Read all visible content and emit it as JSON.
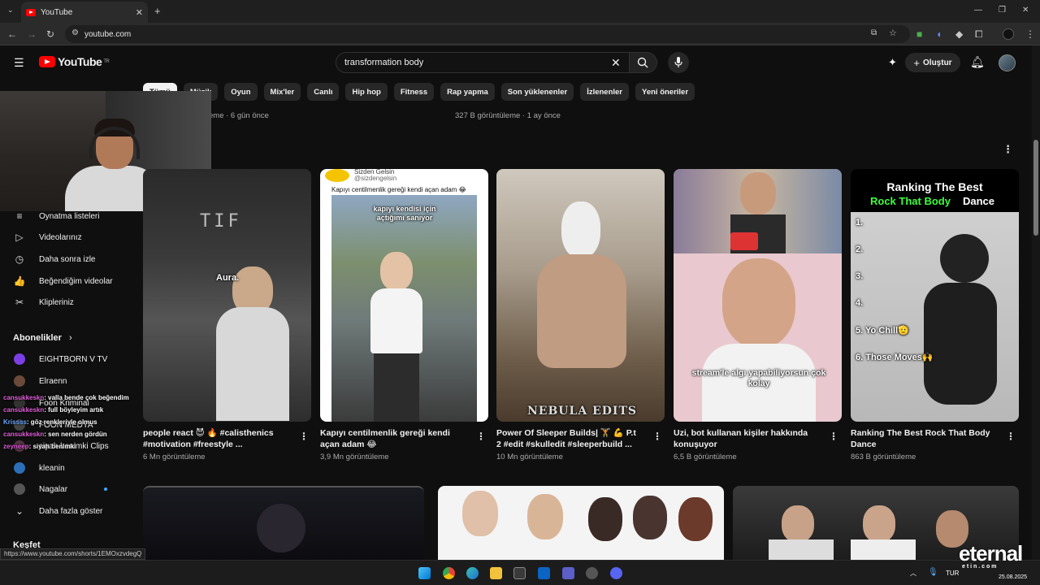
{
  "browser": {
    "tab_title": "YouTube",
    "tab_close": "✕",
    "new_tab": "+",
    "url": "youtube.com",
    "window_controls": [
      "—",
      "❐",
      "✕"
    ]
  },
  "header": {
    "logo_text": "YouTube",
    "logo_region": "TR",
    "search_value": "transformation body",
    "create_label": "Oluştur"
  },
  "chips": [
    "Tümü",
    "Müzik",
    "Oyun",
    "Mix'ler",
    "Canlı",
    "Hip hop",
    "Fitness",
    "Rap yapma",
    "Son yüklenenler",
    "İzlenenler",
    "Yeni öneriler"
  ],
  "above_meta": [
    {
      "text": "eme · 6 gün önce"
    },
    {
      "text": "327 B görüntüleme · 1 ay önce"
    }
  ],
  "sidebar": {
    "you_items": [
      {
        "label": "Oynatma listeleri",
        "icon": "playlist-icon",
        "glyph": "≡"
      },
      {
        "label": "Videolarınız",
        "icon": "video-icon",
        "glyph": "▷"
      },
      {
        "label": "Daha sonra izle",
        "icon": "clock-icon",
        "glyph": "◷"
      },
      {
        "label": "Beğendiğim videolar",
        "icon": "thumbs-up-icon",
        "glyph": "👍"
      },
      {
        "label": "Klipleriniz",
        "icon": "scissors-icon",
        "glyph": "✂"
      }
    ],
    "subscriptions_title": "Abonelikler",
    "subscriptions": [
      {
        "label": "EIGHTBORN V TV",
        "color": "#7b3fe4",
        "dot": false
      },
      {
        "label": "Elraenn",
        "color": "#6b4a3a",
        "dot": false
      },
      {
        "label": "Foon Kriminal",
        "color": "#333333",
        "dot": false
      },
      {
        "label": "FOON MEDYA",
        "color": "#444444",
        "dot": false
      },
      {
        "label": "siyah benimki Clips",
        "color": "#553344",
        "dot": false
      },
      {
        "label": "kleanin",
        "color": "#2a6fb8",
        "dot": false
      },
      {
        "label": "Nagalar",
        "color": "#555555",
        "dot": true
      }
    ],
    "show_more": "Daha fazla göster",
    "explore_title": "Keşfet"
  },
  "shorts": [
    {
      "title": "people react 😈 🔥 #calisthenics #motivation #freestyle ...",
      "views": "6 Mn görüntüleme",
      "overlay": "Aura.",
      "brand": "TIF"
    },
    {
      "title": "Kapıyı centilmenlik gereği kendi açan adam 😂",
      "views": "3,9 Mn görüntüleme",
      "channel": "Sizden Gelsin",
      "handle": "@sizdengelsin",
      "caption": "Kapıyı centilmenlik gereği kendi açan adam 😂",
      "overlay": "kapıyı kendisi için açtığımı sanıyor"
    },
    {
      "title": "Power Of Sleeper Builds| 🏋 💪 P.t 2 #edit #skulledit #sleeperbuild ...",
      "views": "10 Mn görüntüleme",
      "overlay": "NEBULA EDITS"
    },
    {
      "title": "Uzi, bot kullanan kişiler hakkında konuşuyor",
      "views": "6,5 B görüntüleme",
      "overlay": "stream'le algı yapabiliyorsun çok kolay"
    },
    {
      "title": "Ranking The Best Rock That Body Dance",
      "views": "863 B görüntüleme",
      "heading1": "Ranking The Best",
      "heading2a": "Rock That Body",
      "heading2b": "Dance",
      "ranks": [
        "1.",
        "2.",
        "3.",
        "4.",
        "5. Yo Chill🫡",
        "6. Those Moves🙌"
      ]
    }
  ],
  "chat": [
    {
      "user": "cansukkeskn",
      "msg": ": valla bende çok beğendim"
    },
    {
      "user": "cansukkeskn",
      "msg": ": full böyleyim artık"
    },
    {
      "user": "Krissss",
      "msg": ": göz renkleriyle olmus"
    },
    {
      "user": "cansukkeskn",
      "msg": ": sen nerden gördün"
    },
    {
      "user": "zeyneep",
      "msg": ": siyah benimki"
    }
  ],
  "status_url": "https://www.youtube.com/shorts/1EMOxzvdegQ",
  "taskbar": {
    "lang": "TUR",
    "date": "25.08.2025"
  },
  "watermark": "eternal",
  "watermark_sub": "e t i n . c o m"
}
